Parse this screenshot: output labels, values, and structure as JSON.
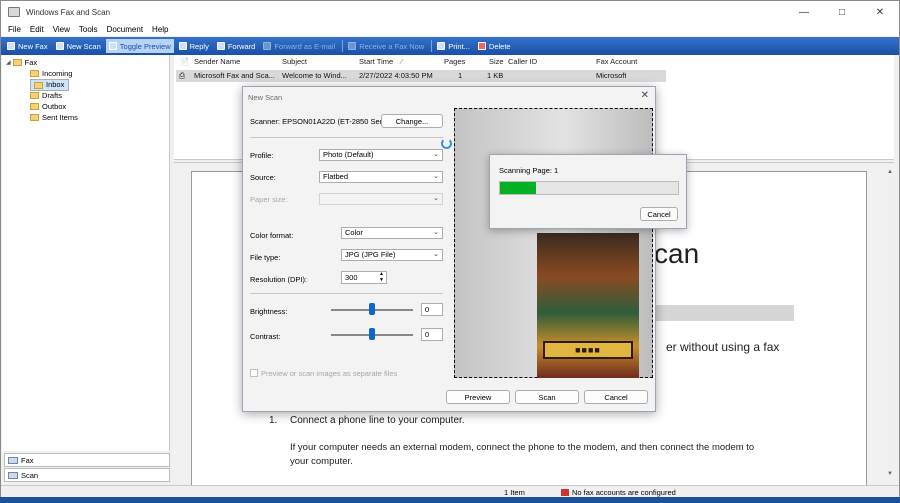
{
  "window": {
    "title": "Windows Fax and Scan"
  },
  "menu": [
    "File",
    "Edit",
    "View",
    "Tools",
    "Document",
    "Help"
  ],
  "toolbar": [
    {
      "label": "New Fax",
      "state": "normal"
    },
    {
      "label": "New Scan",
      "state": "normal"
    },
    {
      "label": "Toggle Preview",
      "state": "highlighted"
    },
    {
      "label": "Reply",
      "state": "normal"
    },
    {
      "label": "Forward",
      "state": "normal"
    },
    {
      "label": "Forward as E-mail",
      "state": "disabled"
    },
    {
      "label": "Receive a Fax Now",
      "state": "disabled"
    },
    {
      "label": "Print...",
      "state": "normal"
    },
    {
      "label": "Delete",
      "state": "normal"
    }
  ],
  "tree": {
    "root": "Fax",
    "items": [
      "Incoming",
      "Inbox",
      "Drafts",
      "Outbox",
      "Sent Items"
    ],
    "selected": "Inbox"
  },
  "nav_buttons": {
    "fax": "Fax",
    "scan": "Scan"
  },
  "list": {
    "columns": [
      "Sender Name",
      "Subject",
      "Start Time",
      "Pages",
      "Size",
      "Caller ID",
      "Fax Account"
    ],
    "rows": [
      {
        "sender": "Microsoft Fax and Sca...",
        "subject": "Welcome to Wind...",
        "start_time": "2/27/2022 4:03:50 PM",
        "pages": "1",
        "size": "1 KB",
        "caller_id": "",
        "account": "Microsoft"
      }
    ]
  },
  "document": {
    "heading_fragment": "can",
    "line_fragment": "er without using a fax",
    "step_number": "1.",
    "step_text": "Connect a phone line to your computer.",
    "step_detail_1": "If your computer needs an external modem, connect the phone to the modem, and then connect the modem to",
    "step_detail_2": "your computer."
  },
  "status": {
    "items": "1 Item",
    "fax_accounts": "No fax accounts are configured"
  },
  "new_scan_dialog": {
    "title": "New Scan",
    "scanner_label": "Scanner: EPSON01A22D (ET-2850 Ser...",
    "change_button": "Change...",
    "profile_label": "Profile:",
    "profile_value": "Photo (Default)",
    "source_label": "Source:",
    "source_value": "Flatbed",
    "paper_size_label": "Paper size:",
    "paper_size_value": "",
    "color_format_label": "Color format:",
    "color_format_value": "Color",
    "file_type_label": "File type:",
    "file_type_value": "JPG (JPG File)",
    "resolution_label": "Resolution (DPI):",
    "resolution_value": "300",
    "brightness_label": "Brightness:",
    "brightness_value": "0",
    "contrast_label": "Contrast:",
    "contrast_value": "0",
    "separate_files_label": "Preview or scan images as separate files",
    "separate_files_checked": false,
    "preview_button": "Preview",
    "scan_button": "Scan",
    "cancel_button": "Cancel"
  },
  "scan_progress": {
    "text": "Scanning Page: 1",
    "progress_fraction": 0.2,
    "cancel_button": "Cancel"
  },
  "colors": {
    "toolbar": "#1a4fa5",
    "progress": "#06b025",
    "selection": "#cfe4fa"
  }
}
